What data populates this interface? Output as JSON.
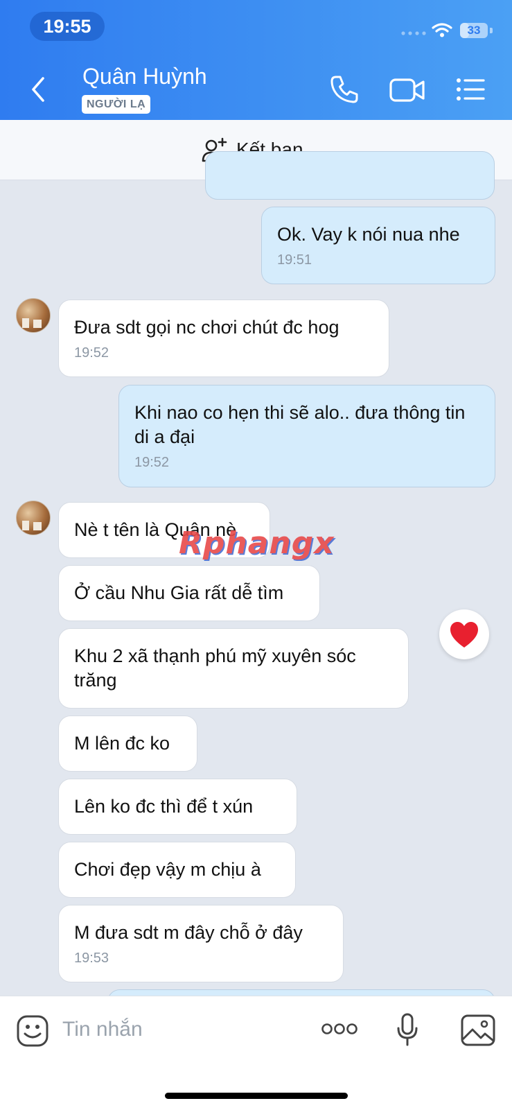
{
  "status_bar": {
    "time": "19:55",
    "battery": "33",
    "battery_fraction": 0.33
  },
  "header": {
    "contact_name": "Quân Huỳnh",
    "badge": "NGƯỜI LẠ",
    "icons": [
      "back-chevron-icon",
      "phone-icon",
      "video-call-icon",
      "menu-list-icon"
    ]
  },
  "add_friend": {
    "label": "Kết bạn",
    "icon": "add-user-icon"
  },
  "messages": [
    {
      "dir": "out",
      "text": "Ok. Vay k nói nua nhe",
      "time": "19:51"
    },
    {
      "dir": "in",
      "text": "Đưa sdt gọi nc chơi chút đc hog",
      "time": "19:52"
    },
    {
      "dir": "out",
      "text": "Khi nao co hẹn thi sẽ alo.. đưa thông tin di a đại",
      "time": "19:52"
    },
    {
      "dir": "in",
      "text": "Nè t tên là Quân nè",
      "time": ""
    },
    {
      "dir": "in",
      "text": "Ở cầu Nhu Gia rất dễ tìm",
      "time": ""
    },
    {
      "dir": "in",
      "text": "Khu 2 xã thạnh phú mỹ xuyên sóc trăng",
      "time": ""
    },
    {
      "dir": "in",
      "text": "M lên đc ko",
      "time": ""
    },
    {
      "dir": "in",
      "text": "Lên ko đc thì để t xún",
      "time": ""
    },
    {
      "dir": "in",
      "text": "Chơi đẹp vậy m chịu à",
      "time": ""
    },
    {
      "dir": "in",
      "text": "M đưa sdt m đây chỗ ở đây",
      "time": "19:53"
    }
  ],
  "watermark": "Rphangx",
  "reaction": {
    "icon": "heart-icon",
    "color": "#e8202f"
  },
  "composer": {
    "placeholder": "Tin nhắn",
    "icons": [
      "emoji-icon",
      "more-options-icon",
      "microphone-icon",
      "image-icon"
    ]
  },
  "colors": {
    "header_start": "#2f7cf0",
    "header_end": "#4ba0f4",
    "outgoing_bubble": "#d5ecfc",
    "incoming_bubble": "#ffffff",
    "chat_background": "#e2e7ef"
  }
}
